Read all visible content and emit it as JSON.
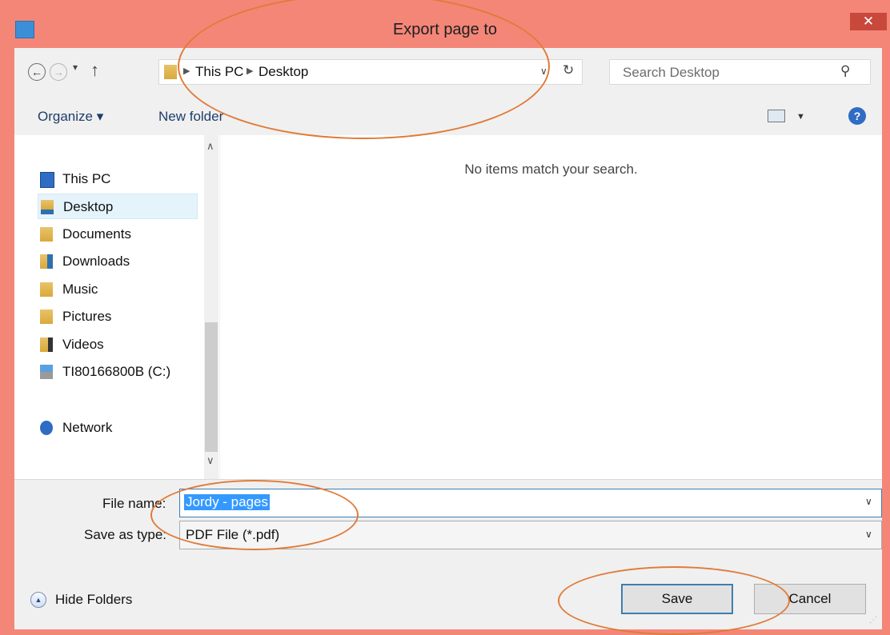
{
  "window": {
    "title": "Export page to",
    "close_glyph": "✕"
  },
  "nav": {
    "back_glyph": "←",
    "forward_glyph": "→",
    "recent_glyph": "▾",
    "up_glyph": "↑",
    "breadcrumbs": [
      "This PC",
      "Desktop"
    ],
    "separator_glyph": "▶",
    "address_dropdown_glyph": "∨",
    "refresh_glyph": "↻",
    "search_placeholder": "Search Desktop",
    "search_glyph": "⚲"
  },
  "toolbar": {
    "organize_label": "Organize ▾",
    "new_folder_label": "New folder",
    "view_dropdown_glyph": "▼",
    "help_glyph": "?"
  },
  "sidebar": {
    "items": [
      {
        "label": "This PC",
        "icon": "computer-icon"
      },
      {
        "label": "Desktop",
        "icon": "desktop-folder-icon",
        "selected": true
      },
      {
        "label": "Documents",
        "icon": "documents-folder-icon"
      },
      {
        "label": "Downloads",
        "icon": "downloads-folder-icon"
      },
      {
        "label": "Music",
        "icon": "music-folder-icon"
      },
      {
        "label": "Pictures",
        "icon": "pictures-folder-icon"
      },
      {
        "label": "Videos",
        "icon": "videos-folder-icon"
      },
      {
        "label": "TI80166800B (C:)",
        "icon": "drive-icon"
      },
      {
        "label": "Network",
        "icon": "network-icon"
      }
    ],
    "scroll_up_glyph": "∧",
    "scroll_down_glyph": "∨"
  },
  "content": {
    "empty_message": "No items match your search."
  },
  "form": {
    "file_name_label": "File name:",
    "file_name_value": "Jordy - pages",
    "save_as_type_label": "Save as type:",
    "save_as_type_value": "PDF File (*.pdf)",
    "dropdown_glyph": "∨"
  },
  "footer": {
    "hide_folders_label": "Hide Folders",
    "hide_glyph": "▲",
    "save_label": "Save",
    "cancel_label": "Cancel",
    "grip_glyph": "⋰"
  },
  "colors": {
    "titlebar": "#f48678",
    "accent": "#3c7fb1",
    "selection": "#3399ff",
    "annotation": "#e07b39"
  }
}
